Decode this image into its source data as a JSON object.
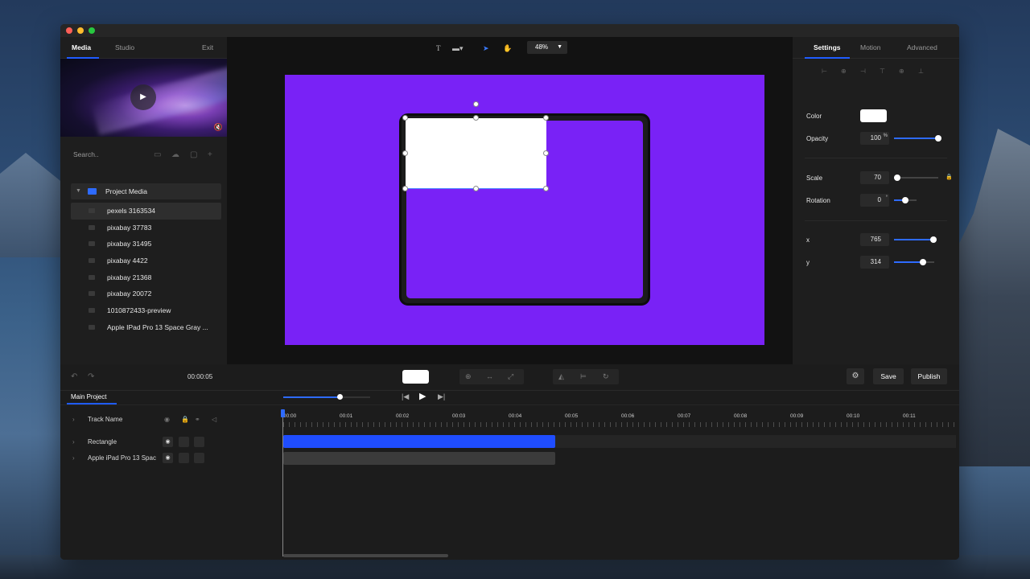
{
  "left_panel": {
    "tabs": [
      "Media",
      "Studio",
      "Exit"
    ],
    "search_placeholder": "Search..",
    "folder": "Project Media",
    "items": [
      "pexels 3163534",
      "pixabay 37783",
      "pixabay 31495",
      "pixabay 4422",
      "pixabay 21368",
      "pixabay 20072",
      "1010872433-preview",
      "Apple IPad Pro 13 Space Gray ..."
    ]
  },
  "toolbar": {
    "zoom": "48%"
  },
  "right_panel": {
    "tabs": [
      "Settings",
      "Motion",
      "Advanced"
    ],
    "color_label": "Color",
    "color_value": "#ffffff",
    "opacity_label": "Opacity",
    "opacity_value": "100",
    "opacity_unit": "%",
    "scale_label": "Scale",
    "scale_value": "70",
    "rotation_label": "Rotation",
    "rotation_value": "0",
    "rotation_unit": "°",
    "x_label": "x",
    "x_value": "765",
    "y_label": "y",
    "y_value": "314"
  },
  "controls": {
    "time": "00:00:05",
    "save": "Save",
    "publish": "Publish"
  },
  "timeline": {
    "tab": "Main Project",
    "header_label": "Track Name",
    "tracks": [
      "Rectangle",
      "Apple iPad Pro 13 Spac"
    ],
    "ticks": [
      "00:00",
      "00:01",
      "00:02",
      "00:03",
      "00:04",
      "00:05",
      "00:06",
      "00:07",
      "00:08",
      "00:09",
      "00:10",
      "00:11"
    ]
  },
  "colors": {
    "accent": "#1f5cff",
    "stage": "#7922f6",
    "clip_blue": "#1f4dff",
    "clip_gray": "#3b3b3b"
  }
}
